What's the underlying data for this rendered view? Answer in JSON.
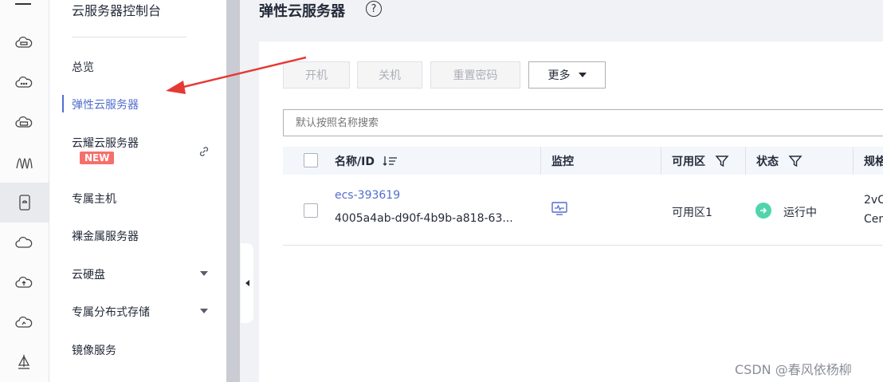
{
  "rail": {
    "icons": [
      "cloud-server-icon",
      "cloud-dots-icon",
      "storage-icon",
      "waveform-icon",
      "device-icon",
      "cloud-icon",
      "cloud-upload-icon",
      "cloud-backup-icon",
      "sailboat-icon"
    ]
  },
  "sidebar": {
    "title": "云服务器控制台",
    "items": [
      {
        "label": "总览"
      },
      {
        "label": "弹性云服务器"
      },
      {
        "label": "云耀云服务器",
        "badge": "NEW"
      },
      {
        "label": "专属主机"
      },
      {
        "label": "裸金属服务器"
      },
      {
        "label": "云硬盘"
      },
      {
        "label": "专属分布式存储"
      },
      {
        "label": "镜像服务"
      }
    ]
  },
  "header": {
    "title": "弹性云服务器"
  },
  "toolbar": {
    "start": "开机",
    "stop": "关机",
    "reset_password": "重置密码",
    "more": "更多"
  },
  "search": {
    "placeholder": "默认按照名称搜索"
  },
  "table": {
    "columns": {
      "name": "名称/ID",
      "monitor": "监控",
      "az": "可用区",
      "status": "状态",
      "spec": "规格"
    },
    "rows": [
      {
        "name": "ecs-393619",
        "id": "4005a4ab-d90f-4b9b-a818-63...",
        "az": "可用区1",
        "status": "运行中",
        "spec_line1": "2vC",
        "spec_line2": "Cen"
      }
    ]
  },
  "watermark": "CSDN @春风依杨柳",
  "colors": {
    "accent": "#526ecc",
    "status_running": "#50d4ab",
    "badge_new": "#f66f6a",
    "arrow": "#e53935"
  }
}
